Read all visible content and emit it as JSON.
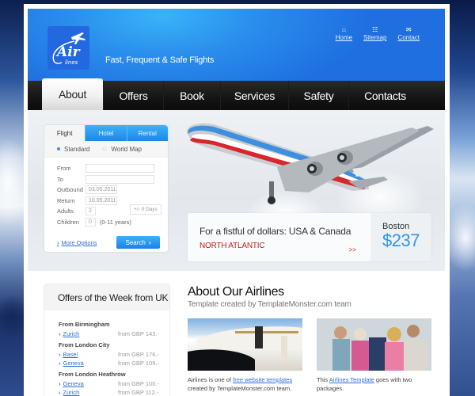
{
  "brand": {
    "logo_text": "Air",
    "logo_subtext": "lines",
    "tagline": "Fast, Frequent & Safe Flights"
  },
  "top_links": [
    {
      "label": "Home",
      "icon": "home-icon"
    },
    {
      "label": "Sitemap",
      "icon": "sitemap-icon"
    },
    {
      "label": "Contact",
      "icon": "mail-icon"
    }
  ],
  "nav": {
    "items": [
      {
        "label": "About",
        "active": true
      },
      {
        "label": "Offers",
        "active": false
      },
      {
        "label": "Book",
        "active": false
      },
      {
        "label": "Services",
        "active": false
      },
      {
        "label": "Safety",
        "active": false
      },
      {
        "label": "Contacts",
        "active": false
      }
    ]
  },
  "booking": {
    "tabs": [
      {
        "label": "Flight",
        "active": true
      },
      {
        "label": "Hotel",
        "active": false
      },
      {
        "label": "Rental",
        "active": false
      }
    ],
    "modes": [
      {
        "label": "Standard",
        "selected": true
      },
      {
        "label": "World Map",
        "selected": false
      }
    ],
    "fields": {
      "from_label": "From",
      "from_value": "",
      "to_label": "To",
      "to_value": "",
      "outbound_label": "Outbound",
      "outbound_value": "03.05.2011",
      "return_label": "Return",
      "return_value": "10.05.2011",
      "flex_days": "+/- 0 Days",
      "adults_label": "Adults",
      "adults_value": "2",
      "children_label": "Children",
      "children_value": "0",
      "children_hint": "(0-11 years)"
    },
    "more_options": "More Options",
    "search_label": "Search"
  },
  "promo": {
    "title": "For a fistful of dollars: USA & Canada",
    "subtitle": "NORTH ATLANTIC",
    "arrow": ">>",
    "city": "Boston",
    "price": "$237"
  },
  "offers": {
    "title": "Offers of the Week from UK",
    "groups": [
      {
        "from": "From Birmingham",
        "items": [
          {
            "dest": "Zurich",
            "price": "from GBP 143.-"
          }
        ]
      },
      {
        "from": "From London City",
        "items": [
          {
            "dest": "Basel",
            "price": "from GBP 176.-"
          },
          {
            "dest": "Geneva",
            "price": "from GBP 109.-"
          }
        ]
      },
      {
        "from": "From London Heathrow",
        "items": [
          {
            "dest": "Geneva",
            "price": "from GBP 100.-"
          },
          {
            "dest": "Zurich",
            "price": "from GBP 112.-"
          }
        ]
      }
    ]
  },
  "about": {
    "title": "About Our Airlines",
    "subtitle": "Template created by TemplateMonster.com team",
    "cards": [
      {
        "text_before": "Airlines is one of ",
        "link": "free website templates",
        "text_after": " created by TemplateMonster.com team."
      },
      {
        "text_before": "This ",
        "link": "Airlines Template",
        "text_after": " goes with two packages."
      }
    ]
  }
}
